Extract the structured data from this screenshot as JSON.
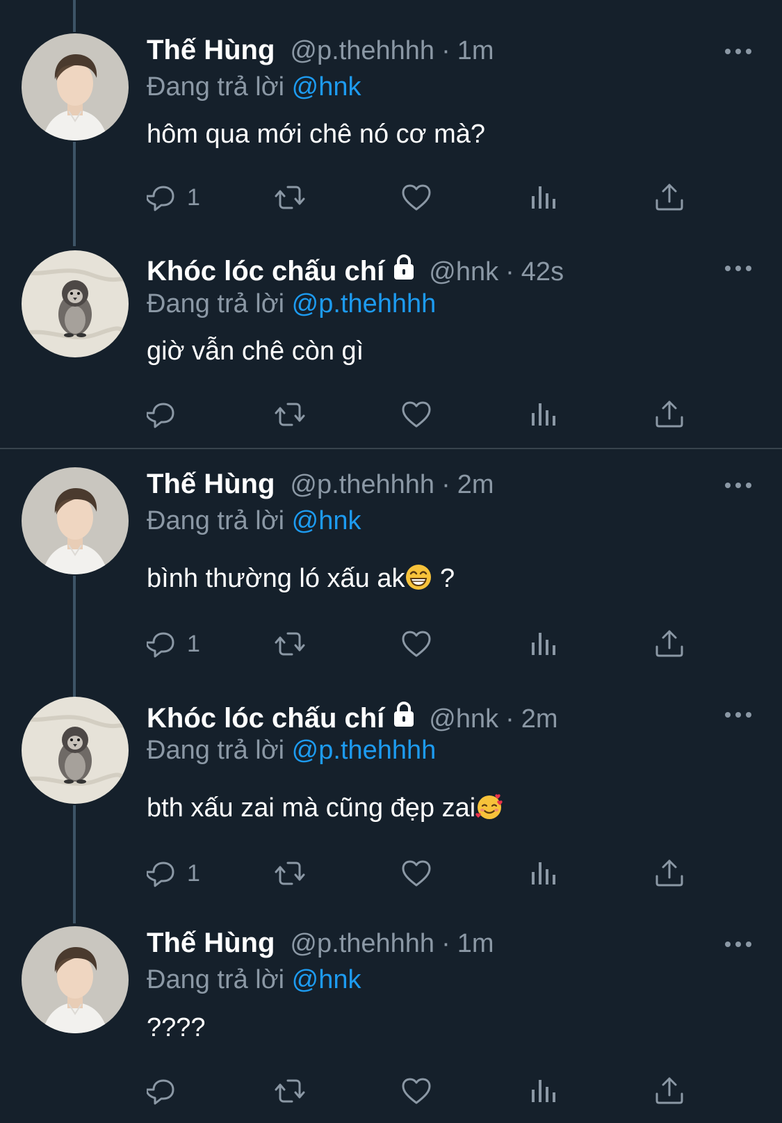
{
  "reply_prefix": "Đang trả lời",
  "tweets": [
    {
      "author": "Thế Hùng",
      "handle": "@p.thehhhh",
      "time": "1m",
      "locked": false,
      "reply_to": "@hnk",
      "text": "hôm qua mới chê nó cơ mà?",
      "reply_count": "1"
    },
    {
      "author": "Khóc lóc chấu chí",
      "handle": "@hnk",
      "time": "42s",
      "locked": true,
      "reply_to": "@p.thehhhh",
      "text": "giờ vẫn chê còn gì",
      "reply_count": ""
    },
    {
      "author": "Thế Hùng",
      "handle": "@p.thehhhh",
      "time": "2m",
      "locked": false,
      "reply_to": "@hnk",
      "text_before_emoji": "bình thường ló xấu ak",
      "text_after_emoji": " ?",
      "emoji": "grinning-face",
      "reply_count": "1"
    },
    {
      "author": "Khóc lóc chấu chí",
      "handle": "@hnk",
      "time": "2m",
      "locked": true,
      "reply_to": "@p.thehhhh",
      "text_before_emoji": "bth xấu zai mà cũng đẹp zai",
      "text_after_emoji": "",
      "emoji": "smiling-face-with-hearts",
      "reply_count": "1"
    },
    {
      "author": "Thế Hùng",
      "handle": "@p.thehhhh",
      "time": "1m",
      "locked": false,
      "reply_to": "@hnk",
      "text": "????",
      "reply_count": ""
    }
  ],
  "colors": {
    "background": "#15202b",
    "secondary_text": "#8b98a5",
    "mention": "#1d9bf0",
    "thread_line": "#3d5466",
    "divider": "#38444d"
  }
}
